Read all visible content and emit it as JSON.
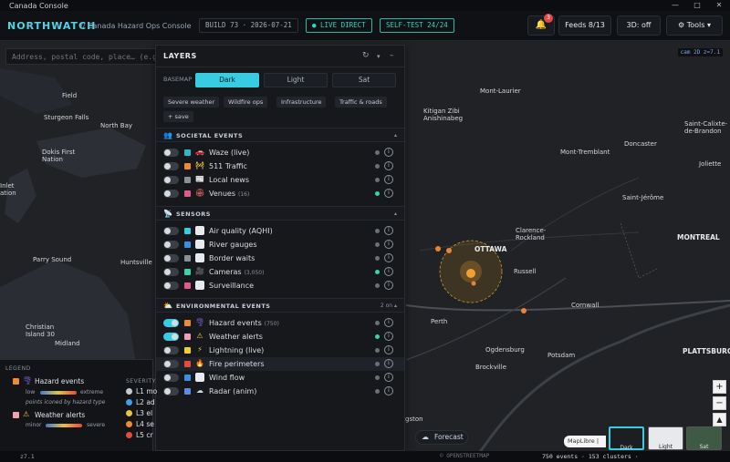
{
  "window": {
    "title": "Canada Console",
    "controls": [
      "—",
      "□",
      "✕"
    ]
  },
  "header": {
    "brand": "NORTHWATCH",
    "subtitle": "// Canada Hazard Ops Console",
    "build": "BUILD 73 · 2026-07-21",
    "live": "● LIVE DIRECT",
    "selftest": "SELF-TEST 24/24",
    "alert_count": "3",
    "feeds": "Feeds 8/13",
    "mode3d": "3D: off",
    "tools": "Tools ▾"
  },
  "map": {
    "search_placeholder": "Address, postal code, place… (e.g. 1",
    "cam_tag": "cam 2D  z=7.1",
    "places": {
      "field": "Field",
      "sturgeon": "Sturgeon Falls",
      "northbay": "North Bay",
      "dokis": "Dokis First\nNation",
      "inlet": "Inlet\nation",
      "parry": "Parry Sound",
      "huntsville": "Huntsville",
      "christian": "Christian\nIsland 30",
      "midland": "Midland",
      "montlaurier": "Mont-Laurier",
      "kitigan": "Kitigan Zibi\nAnishinabeg",
      "mtremblant": "Mont-Tremblant",
      "donc": "Doncaster",
      "stcome": "Saint-Calixte-\nde-Brandon",
      "joliette": "Joliette",
      "stjerome": "Saint-Jérôme",
      "clarence": "Clarence-\nRockland",
      "ottawa": "OTTAWA",
      "russell": "Russell",
      "montreal": "MONTREAL",
      "cornwall": "Cornwall",
      "perth": "Perth",
      "ogdensburg": "Ogdensburg",
      "potsdam": "Potsdam",
      "brockville": "Brockville",
      "plattsburgh": "PLATTSBURGH",
      "gston": "gston"
    },
    "forecast": "Forecast",
    "attribution": "MapLibre | © ",
    "zoom_in": "+",
    "zoom_out": "−",
    "compass": "▲",
    "thumbs": [
      "Dark",
      "Light",
      "Sat"
    ]
  },
  "layers": {
    "title": "LAYERS",
    "basemap_label": "BASEMAP",
    "basemaps": [
      "Dark",
      "Light",
      "Sat"
    ],
    "presets": [
      "Severe weather",
      "Wildfire ops",
      "Infrastructure",
      "Traffic & roads",
      "+ save"
    ],
    "sections": [
      {
        "title": "SOCIETAL EVENTS",
        "right": "▴",
        "rows": [
          {
            "label": "Waze (live)",
            "count": ""
          },
          {
            "label": "511 Traffic",
            "count": ""
          },
          {
            "label": "Local news",
            "count": ""
          },
          {
            "label": "Venues",
            "count": "(16)"
          }
        ]
      },
      {
        "title": "SENSORS",
        "right": "▴",
        "rows": [
          {
            "label": "Air quality (AQHI)",
            "count": ""
          },
          {
            "label": "River gauges",
            "count": ""
          },
          {
            "label": "Border waits",
            "count": ""
          },
          {
            "label": "Cameras",
            "count": "(3,050)"
          },
          {
            "label": "Surveillance",
            "count": ""
          }
        ]
      },
      {
        "title": "ENVIRONMENTAL EVENTS",
        "right": "2 on ▴",
        "rows": [
          {
            "label": "Hazard events",
            "count": "(750)"
          },
          {
            "label": "Weather alerts",
            "count": ""
          },
          {
            "label": "Lightning (live)",
            "count": ""
          },
          {
            "label": "Fire perimeters",
            "count": ""
          },
          {
            "label": "Wind flow",
            "count": ""
          },
          {
            "label": "Radar (anim)",
            "count": ""
          }
        ]
      }
    ]
  },
  "legend": {
    "title": "LEGEND",
    "hazard": "Hazard events",
    "low": "low",
    "extreme": "extreme",
    "note": "points iconed by hazard type",
    "weather": "Weather alerts",
    "minor": "minor",
    "severe": "severe",
    "severity_title": "SEVERITY",
    "levels": [
      "L1 mo",
      "L2 ad",
      "L3 el",
      "L4 se",
      "L5 cr"
    ]
  },
  "status": {
    "left": "z7.1",
    "right": "750 events · 153 clusters · ",
    "attribution": "© OPENSTREETMAP"
  },
  "colors": {
    "accent": "#38cce2",
    "brand": "#4fd4e6",
    "live": "#36d3bd",
    "alert": "#e0484a"
  }
}
